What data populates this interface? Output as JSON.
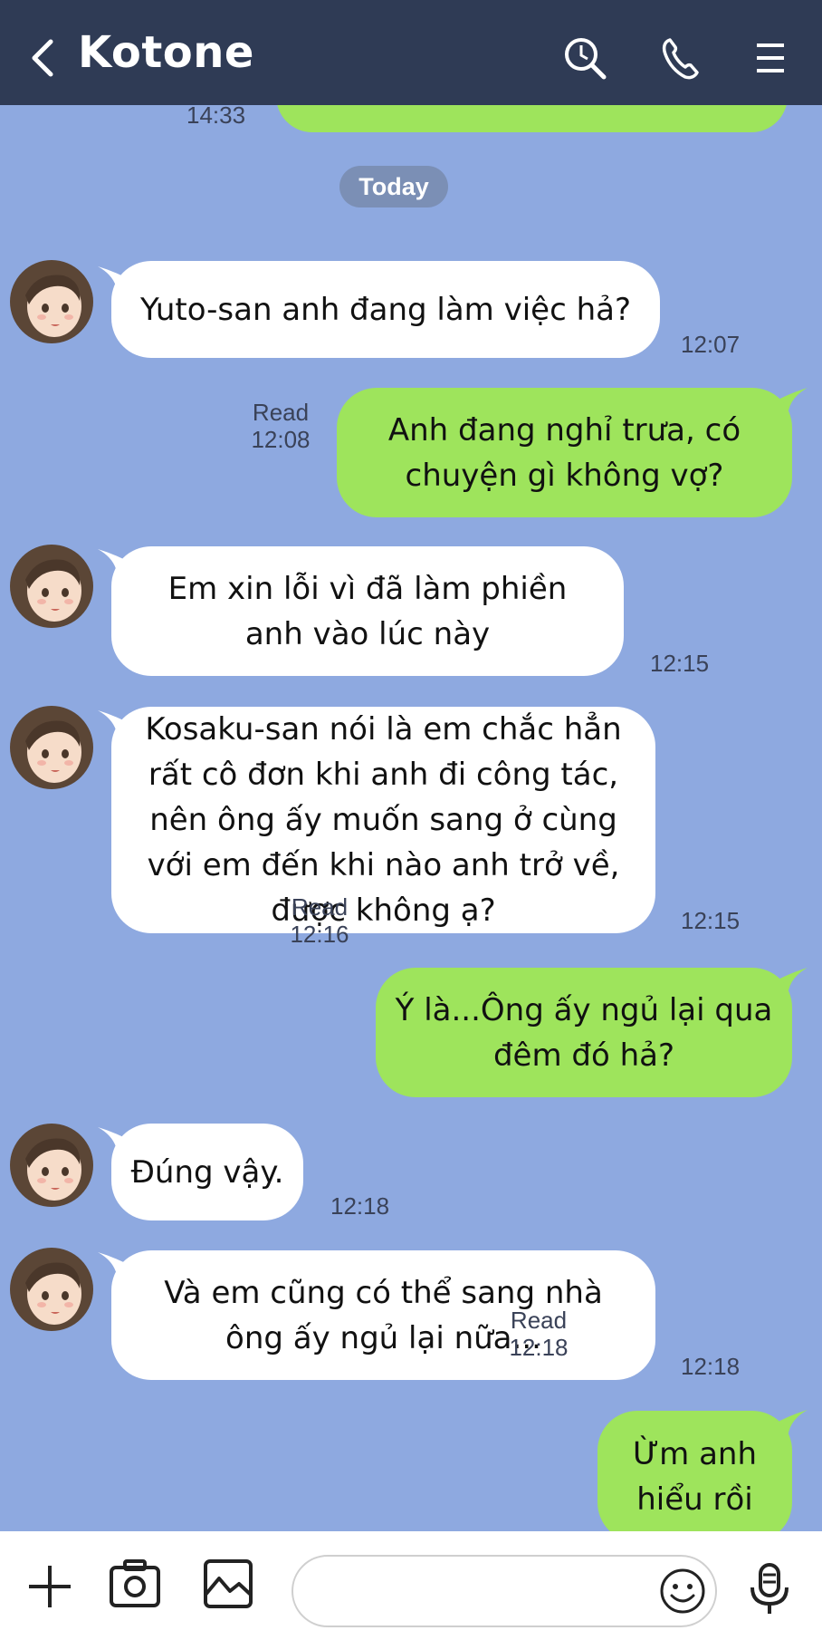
{
  "header": {
    "title": "Kotone",
    "icons": [
      "back-icon",
      "search-icon",
      "phone-icon",
      "menu-icon"
    ]
  },
  "chat": {
    "previous_time": "14:33",
    "date_divider": "Today",
    "messages": [
      {
        "side": "in",
        "text": "Yuto-san anh đang làm việc hả?",
        "time": "12:07"
      },
      {
        "side": "out",
        "text": "Anh đang nghỉ trưa, có chuyện gì không vợ?",
        "read": "Read",
        "time": "12:08"
      },
      {
        "side": "in",
        "text": "Em xin lỗi vì đã làm phiền anh vào lúc này",
        "time": "12:15"
      },
      {
        "side": "in",
        "text": "Kosaku-san nói là em chắc hẳn rất cô đơn khi anh đi công tác, nên ông ấy muốn sang ở cùng với em đến khi nào anh trở về, được không ạ?",
        "time": "12:15"
      },
      {
        "side": "out",
        "text": "Ý là...Ông ấy ngủ lại qua đêm đó hả?",
        "read": "Read",
        "time": "12:16"
      },
      {
        "side": "in",
        "text": "Đúng vậy.",
        "time": "12:18"
      },
      {
        "side": "in",
        "text": "Và em cũng có thể sang nhà ông ấy ngủ lại nữa...",
        "time": "12:18"
      },
      {
        "side": "out",
        "text": "Ừm anh hiểu rồi",
        "read": "Read",
        "time": "12:18"
      }
    ]
  },
  "input_bar": {
    "placeholder": "",
    "icons": [
      "plus-icon",
      "camera-icon",
      "image-icon",
      "emoji-icon",
      "mic-icon"
    ]
  },
  "colors": {
    "header_bg": "#2f3b55",
    "chat_bg": "#8ea9e0",
    "incoming_bubble": "#ffffff",
    "outgoing_bubble": "#9ee45c",
    "date_pill": "#7b8fb5"
  }
}
